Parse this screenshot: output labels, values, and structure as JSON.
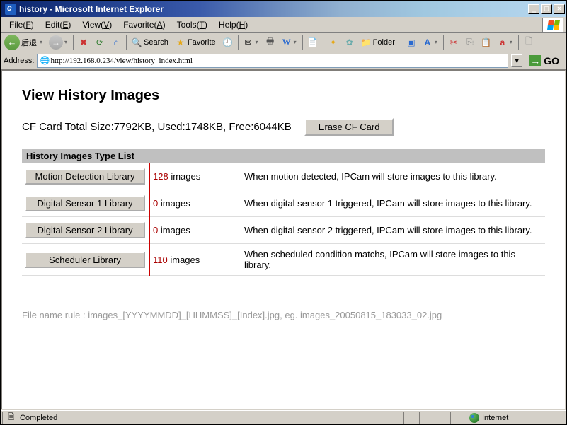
{
  "window": {
    "title": "history - Microsoft Internet Explorer"
  },
  "menubar": {
    "file": "File(F)",
    "edit": "Edit(E)",
    "view": "View(V)",
    "favorite": "Favorite(A)",
    "tools": "Tools(T)",
    "help": "Help(H)"
  },
  "toolbar": {
    "back_label": "后退",
    "search_label": "Search",
    "favorite_label": "Favorite",
    "folder_label": "Folder"
  },
  "addressbar": {
    "label": "Address:",
    "url": "http://192.168.0.234/view/history_index.html",
    "go": "GO"
  },
  "page": {
    "heading": "View History Images",
    "cf_line": "CF Card Total Size:7792KB, Used:1748KB, Free:6044KB",
    "erase_btn": "Erase CF Card",
    "list_header": "History Images Type List",
    "rows": [
      {
        "lib": "Motion Detection Library",
        "count": "128",
        "unit": " images",
        "desc": "When motion detected, IPCam will store images to this library."
      },
      {
        "lib": "Digital Sensor 1 Library",
        "count": "0",
        "unit": " images",
        "desc": "When digital sensor 1 triggered, IPCam will store images to this library."
      },
      {
        "lib": "Digital Sensor 2 Library",
        "count": "0",
        "unit": " images",
        "desc": "When digital sensor 2 triggered, IPCam will store images to this library."
      },
      {
        "lib": "Scheduler Library",
        "count": "110",
        "unit": " images",
        "desc": "When scheduled condition matchs, IPCam will store images to this library."
      }
    ],
    "file_rule": "File name rule : images_[YYYYMMDD]_[HHMMSS]_[Index].jpg, eg. images_20050815_183033_02.jpg"
  },
  "statusbar": {
    "status": "Completed",
    "zone": "Internet"
  }
}
